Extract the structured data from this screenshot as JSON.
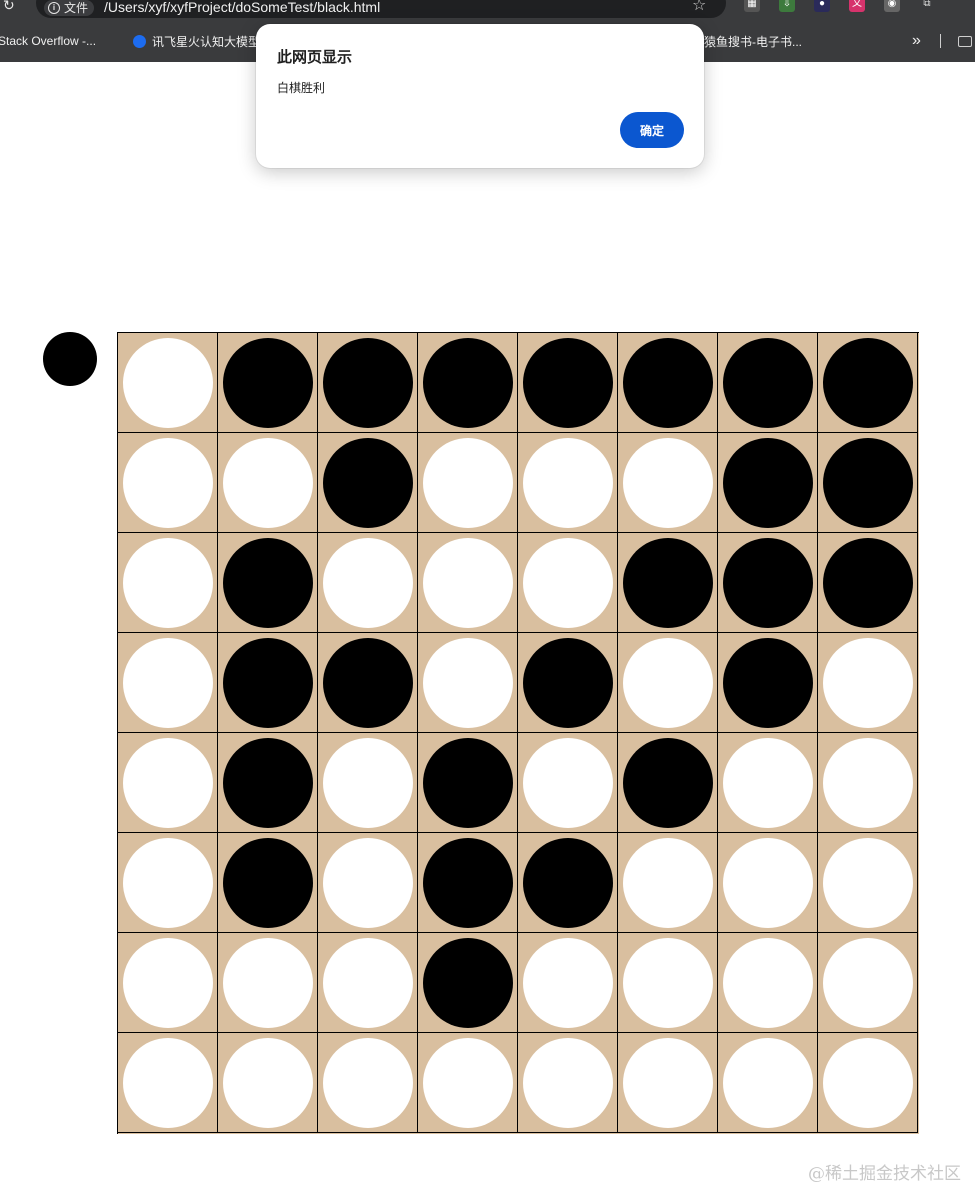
{
  "browser": {
    "site_info_label": "文件",
    "url": "/Users/xyf/xyfProject/doSomeTest/black.html",
    "bookmarks": [
      {
        "label": "Stack Overflow -...",
        "color": "#f48024"
      },
      {
        "label": "讯飞星火认知大模型",
        "color": "#1d6cf0"
      },
      {
        "label": "猿鱼搜书-电子书...",
        "color": "#3a8f4a"
      }
    ],
    "overflow_label": "»"
  },
  "dialog": {
    "title": "此网页显示",
    "message": "白棋胜利",
    "ok_label": "确定",
    "button_color": "#0b57d0"
  },
  "game": {
    "current_turn": "black",
    "board_color": "#d9bf9f",
    "black_color": "#000000",
    "white_color": "#ffffff",
    "board": [
      [
        "W",
        "B",
        "B",
        "B",
        "B",
        "B",
        "B",
        "B"
      ],
      [
        "W",
        "W",
        "B",
        "W",
        "W",
        "W",
        "B",
        "B"
      ],
      [
        "W",
        "B",
        "W",
        "W",
        "W",
        "B",
        "B",
        "B"
      ],
      [
        "W",
        "B",
        "B",
        "W",
        "B",
        "W",
        "B",
        "W"
      ],
      [
        "W",
        "B",
        "W",
        "B",
        "W",
        "B",
        "W",
        "W"
      ],
      [
        "W",
        "B",
        "W",
        "B",
        "B",
        "W",
        "W",
        "W"
      ],
      [
        "W",
        "W",
        "W",
        "B",
        "W",
        "W",
        "W",
        "W"
      ],
      [
        "W",
        "W",
        "W",
        "W",
        "W",
        "W",
        "W",
        "W"
      ]
    ]
  },
  "watermark": "@稀土掘金技术社区"
}
